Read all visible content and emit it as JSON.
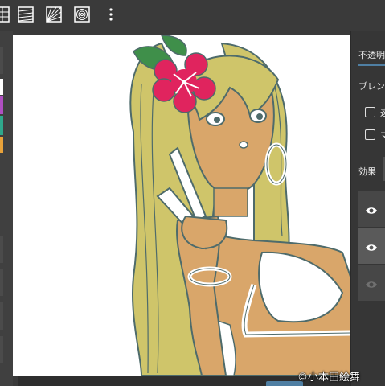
{
  "toolbar": {
    "icons": [
      "grid-icon",
      "parallel-lines-icon",
      "perspective-lines-icon",
      "concentric-circles-icon",
      "more-vertical-icon"
    ]
  },
  "left_panel": {
    "swatches": [
      "#ffffff",
      "#b04fc2",
      "#2fa88c",
      "#e8a23a"
    ]
  },
  "right_panel": {
    "opacity_label": "不透明",
    "blend_label": "ブレン",
    "checkbox1_label": "这",
    "checkbox2_label": "マ",
    "effect_label": "効果",
    "layers": [
      {
        "visible": true,
        "active": false
      },
      {
        "visible": true,
        "active": true
      },
      {
        "visible": false,
        "active": false
      }
    ]
  },
  "colors": {
    "accent": "#4f7fa3",
    "panel_bg": "#3a3a3a",
    "canvas_bg": "#ffffff",
    "skin": "#d9a66a",
    "hair": "#cfc56a",
    "flower": "#e0245e",
    "leaf": "#3f8f4a",
    "line": "#4e6b6b"
  },
  "credit": "©小本田絵舞"
}
